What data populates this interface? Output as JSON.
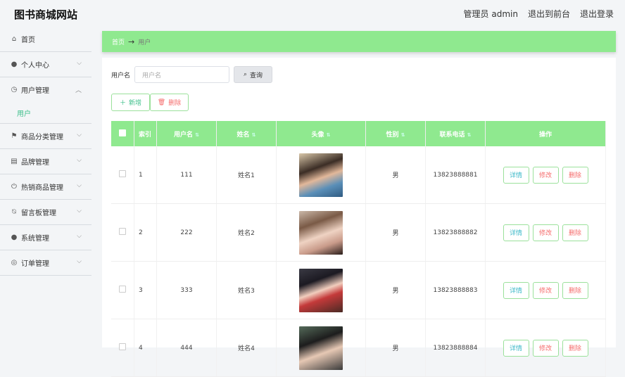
{
  "brand": "图书商城网站",
  "topnav": {
    "admin": "管理员 admin",
    "front": "退出到前台",
    "logout": "退出登录"
  },
  "sidebar": {
    "items": [
      {
        "label": "首页",
        "icon": "home-icon",
        "glyph": "⌂"
      },
      {
        "label": "个人中心",
        "icon": "user-icon",
        "glyph": "●"
      },
      {
        "label": "用户管理",
        "icon": "clock-icon",
        "glyph": "◷"
      },
      {
        "label": "商品分类管理",
        "icon": "flag-icon",
        "glyph": "⚑"
      },
      {
        "label": "品牌管理",
        "icon": "clipboard-icon",
        "glyph": "▤"
      },
      {
        "label": "热销商品管理",
        "icon": "power-icon",
        "glyph": "⏻"
      },
      {
        "label": "留言板管理",
        "icon": "bell-off-icon",
        "glyph": "⍉"
      },
      {
        "label": "系统管理",
        "icon": "person-icon",
        "glyph": "●"
      },
      {
        "label": "订单管理",
        "icon": "target-icon",
        "glyph": "◎"
      }
    ],
    "subitem": "用户"
  },
  "breadcrumb": {
    "home": "首页",
    "arrow": "→",
    "current": "用户"
  },
  "search": {
    "label": "用户名",
    "placeholder": "用户名",
    "button": "查询"
  },
  "actions": {
    "add": "新增",
    "delete": "删除"
  },
  "table": {
    "headers": [
      "索引",
      "用户名",
      "姓名",
      "头像",
      "性别",
      "联系电话",
      "操作"
    ],
    "rows": [
      {
        "index": "1",
        "username": "111",
        "name": "姓名1",
        "gender": "男",
        "phone": "13823888881"
      },
      {
        "index": "2",
        "username": "222",
        "name": "姓名2",
        "gender": "男",
        "phone": "13823888882"
      },
      {
        "index": "3",
        "username": "333",
        "name": "姓名3",
        "gender": "男",
        "phone": "13823888883"
      },
      {
        "index": "4",
        "username": "444",
        "name": "姓名4",
        "gender": "男",
        "phone": "13823888884"
      }
    ],
    "ops": {
      "detail": "详情",
      "edit": "修改",
      "delete": "删除"
    }
  },
  "colors": {
    "accent": "#8fe98f",
    "active": "#3cbf8a",
    "danger": "#f56c6c"
  }
}
